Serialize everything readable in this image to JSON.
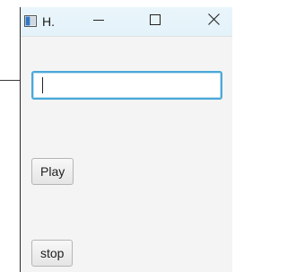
{
  "window": {
    "title": "H.",
    "icons": {
      "app": "app-window-icon",
      "minimize": "minimize-icon",
      "maximize": "maximize-icon",
      "close": "close-icon"
    }
  },
  "form": {
    "text_input": {
      "value": "",
      "placeholder": ""
    },
    "play_label": "Play",
    "stop_label": "stop"
  },
  "colors": {
    "titlebar": "#e6f3fa",
    "window_bg": "#f4f4f4",
    "focus_border": "#4aa8d8"
  }
}
